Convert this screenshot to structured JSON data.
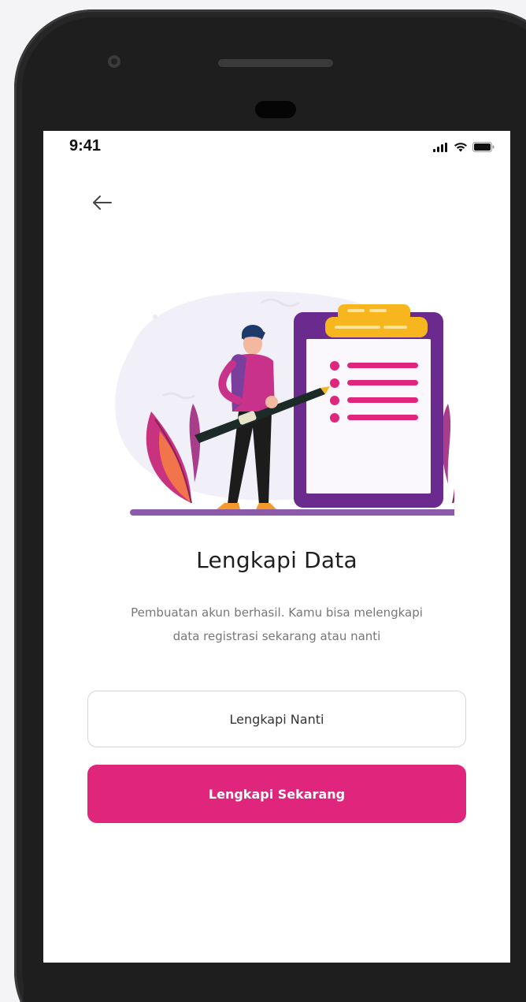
{
  "status_bar": {
    "time": "9:41",
    "icons": [
      "cellular-signal-icon",
      "wifi-icon",
      "battery-icon"
    ]
  },
  "nav": {
    "back_icon": "arrow-left-icon"
  },
  "content": {
    "title": "Lengkapi Data",
    "subtitle_line1": "Pembuatan akun berhasil. Kamu bisa melengkapi",
    "subtitle_line2": "data registrasi sekarang atau nanti"
  },
  "actions": {
    "later_label": "Lengkapi Nanti",
    "now_label": "Lengkapi Sekarang"
  },
  "colors": {
    "primary": "#e0267c",
    "clipboard_purple": "#6a2a8e",
    "clip_yellow": "#f7b51e",
    "text_dark": "#1f1f1f",
    "text_muted": "#777777"
  }
}
